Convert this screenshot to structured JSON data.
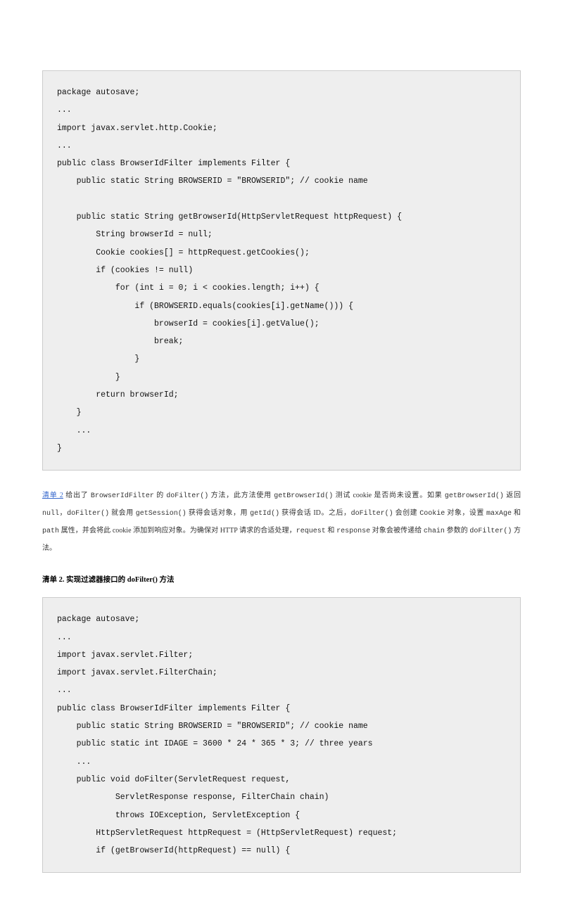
{
  "code1": "package autosave;\n...\nimport javax.servlet.http.Cookie;\n...\npublic class BrowserIdFilter implements Filter {\n    public static String BROWSERID = \"BROWSERID\"; // cookie name\n\n    public static String getBrowserId(HttpServletRequest httpRequest) {\n        String browserId = null;\n        Cookie cookies[] = httpRequest.getCookies();\n        if (cookies != null)\n            for (int i = 0; i < cookies.length; i++) {\n                if (BROWSERID.equals(cookies[i].getName())) {\n                    browserId = cookies[i].getValue();\n                    break;\n                }\n            }\n        return browserId;\n    }\n    ...\n}",
  "para": {
    "link": "清单 2",
    "t1": " 给出了 ",
    "c1": "BrowserIdFilter",
    "t2": " 的 ",
    "c2": "doFilter()",
    "t3": " 方法，此方法使用 ",
    "c3": "getBrowserId()",
    "t4": " 测试 cookie 是否尚未设置。如果 ",
    "c4": "getBrowserId()",
    "t5": " 返回 ",
    "c5": "null",
    "t6": "，",
    "c6": "doFilter()",
    "t7": " 就会用 ",
    "c7": "getSession()",
    "t8": " 获得会话对象，用 ",
    "c8": "getId()",
    "t9": " 获得会话 ID。之后，",
    "c9": "doFilter()",
    "t10": " 会创建 ",
    "c10": "Cookie",
    "t11": " 对象，设置 ",
    "c11": "maxAge",
    "t12": " 和 ",
    "c12": "path",
    "t13": " 属性，并会将此 cookie 添加到响应对象。为确保对 HTTP 请求的合适处理，",
    "c13": "request",
    "t14": " 和 ",
    "c14": "response",
    "t15": " 对象会被传递给 ",
    "c15": "chain",
    "t16": " 参数的 ",
    "c16": "doFilter()",
    "t17": " 方法。"
  },
  "listing_title": "清单 2. 实现过滤器接口的 doFilter() 方法",
  "code2": "package autosave;\n...\nimport javax.servlet.Filter;\nimport javax.servlet.FilterChain;\n...\npublic class BrowserIdFilter implements Filter {\n    public static String BROWSERID = \"BROWSERID\"; // cookie name\n    public static int IDAGE = 3600 * 24 * 365 * 3; // three years\n    ...\n    public void doFilter(ServletRequest request,\n            ServletResponse response, FilterChain chain)\n            throws IOException, ServletException {\n        HttpServletRequest httpRequest = (HttpServletRequest) request;\n        if (getBrowserId(httpRequest) == null) {"
}
